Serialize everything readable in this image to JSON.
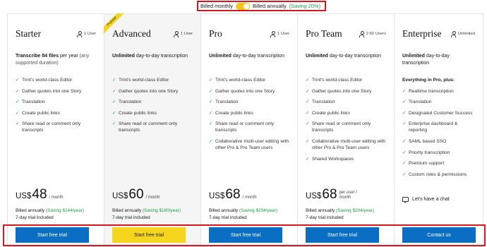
{
  "billing_toggle": {
    "monthly_label": "Billed monthly",
    "annual_label": "Billed annually",
    "annual_saving": "(Saving 20%)",
    "selected": "annually"
  },
  "popular_badge": "Popular",
  "plans": [
    {
      "name": "Starter",
      "users": "1 User",
      "desc_bold": "Transcribe 84 files",
      "desc_rest": " per year",
      "desc_muted": " (any supported duration)",
      "features": [
        "Trint's world-class Editor",
        "Gather quotes into one Story",
        "Translation",
        "Create public links",
        "Share read or comment only transcripts"
      ],
      "currency": "US$",
      "price": "48",
      "per": "/ month",
      "billed": "Billed annually",
      "saving": "(Saving $144/year)",
      "trial": "7-day trial included",
      "cta": "Start free trial"
    },
    {
      "name": "Advanced",
      "users": "1 User",
      "desc_bold": "Unlimited",
      "desc_rest": " day-to-day transcription",
      "features": [
        "Trint's world-class Editor",
        "Gather quotes into one Story",
        "Translation",
        "Create public links",
        "Share read or comment only transcripts"
      ],
      "currency": "US$",
      "price": "60",
      "per": "/ month",
      "billed": "Billed annually",
      "saving": "(Saving $180/year)",
      "trial": "7-day trial included",
      "cta": "Start free trial"
    },
    {
      "name": "Pro",
      "users": "1 User",
      "desc_bold": "Unlimited",
      "desc_rest": " day-to-day transcription",
      "features": [
        "Trint's world-class Editor",
        "Gather quotes into one Story",
        "Translation",
        "Create public links",
        "Share read or comment only transcripts",
        "Collaborative multi-user editing with other Pro & Pro Team users"
      ],
      "currency": "US$",
      "price": "68",
      "per": "/ month",
      "billed": "Billed annually",
      "saving": "(Saving $204/year)",
      "trial": "7-day trial included",
      "cta": "Start free trial"
    },
    {
      "name": "Pro Team",
      "users": "2-50 Users",
      "desc_bold": "Unlimited",
      "desc_rest": " day-to-day transcription",
      "features": [
        "Trint's world-class Editor",
        "Gather quotes into one Story",
        "Translation",
        "Create public links",
        "Share read or comment only transcripts",
        "Collaborative multi-user editing with other Pro & Pro Team users",
        "Shared Workspaces"
      ],
      "currency": "US$",
      "price": "68",
      "per": "per user / month",
      "billed": "Billed annually",
      "saving": "(Saving $204/year)",
      "trial": "7-day trial included",
      "cta": "Start free trial"
    },
    {
      "name": "Enterprise",
      "users": "Unlimited",
      "desc_bold": "Unlimited",
      "desc_rest": " day-to-day transcription",
      "features_intro": "Everything in Pro, plus:",
      "features": [
        "Realtime transcription",
        "Translation",
        "Designated Customer Success",
        "Enterprise dashboard & reporting",
        "SAML based SSO",
        "Priority transcription",
        "Premium support",
        "Custom roles & permissions"
      ],
      "chat_label": "Let's have a chat",
      "cta": "Contact us"
    }
  ],
  "colors": {
    "accent_blue": "#0a6fc2",
    "accent_yellow": "#f6d51f",
    "saving_green": "#1a9d45",
    "highlight_red": "#d7191f"
  }
}
